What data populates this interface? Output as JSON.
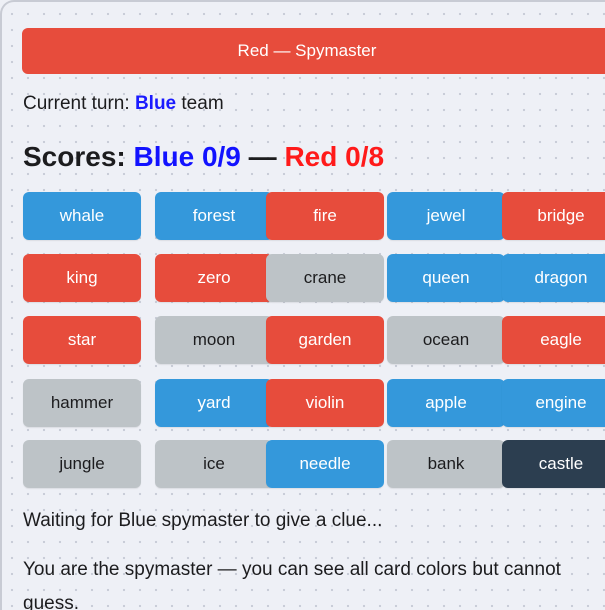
{
  "role_banner": {
    "label": "Red — Spymaster",
    "color": "#e74c3c"
  },
  "turn": {
    "prefix": "Current turn: ",
    "team": "Blue",
    "suffix": " team",
    "team_color": "#1a1aff"
  },
  "scores": {
    "prefix": "Scores: ",
    "blue_label": "Blue 0/9",
    "separator": " — ",
    "red_label": "Red 0/8",
    "blue_color": "#1212ff",
    "red_color": "#ff1a1a"
  },
  "card_colors": {
    "blue": {
      "bg": "#3498db",
      "fg": "#ffffff"
    },
    "red": {
      "bg": "#e74c3c",
      "fg": "#ffffff"
    },
    "neutral": {
      "bg": "#bdc3c7",
      "fg": "#1c1c1e"
    },
    "assassin": {
      "bg": "#2c3e50",
      "fg": "#ffffff"
    }
  },
  "board": {
    "cards": [
      {
        "word": "whale",
        "team": "blue"
      },
      {
        "word": "forest",
        "team": "blue"
      },
      {
        "word": "fire",
        "team": "red"
      },
      {
        "word": "jewel",
        "team": "blue"
      },
      {
        "word": "bridge",
        "team": "red"
      },
      {
        "word": "king",
        "team": "red"
      },
      {
        "word": "zero",
        "team": "red"
      },
      {
        "word": "crane",
        "team": "neutral"
      },
      {
        "word": "queen",
        "team": "blue"
      },
      {
        "word": "dragon",
        "team": "blue"
      },
      {
        "word": "star",
        "team": "red"
      },
      {
        "word": "moon",
        "team": "neutral"
      },
      {
        "word": "garden",
        "team": "red"
      },
      {
        "word": "ocean",
        "team": "neutral"
      },
      {
        "word": "eagle",
        "team": "red"
      },
      {
        "word": "hammer",
        "team": "neutral"
      },
      {
        "word": "yard",
        "team": "blue"
      },
      {
        "word": "violin",
        "team": "red"
      },
      {
        "word": "apple",
        "team": "blue"
      },
      {
        "word": "engine",
        "team": "blue"
      },
      {
        "word": "jungle",
        "team": "neutral"
      },
      {
        "word": "ice",
        "team": "neutral"
      },
      {
        "word": "needle",
        "team": "blue"
      },
      {
        "word": "bank",
        "team": "neutral"
      },
      {
        "word": "castle",
        "team": "assassin"
      }
    ]
  },
  "status": "Waiting for Blue spymaster to give a clue...",
  "info": "You are the spymaster — you can see all card colors but cannot guess."
}
